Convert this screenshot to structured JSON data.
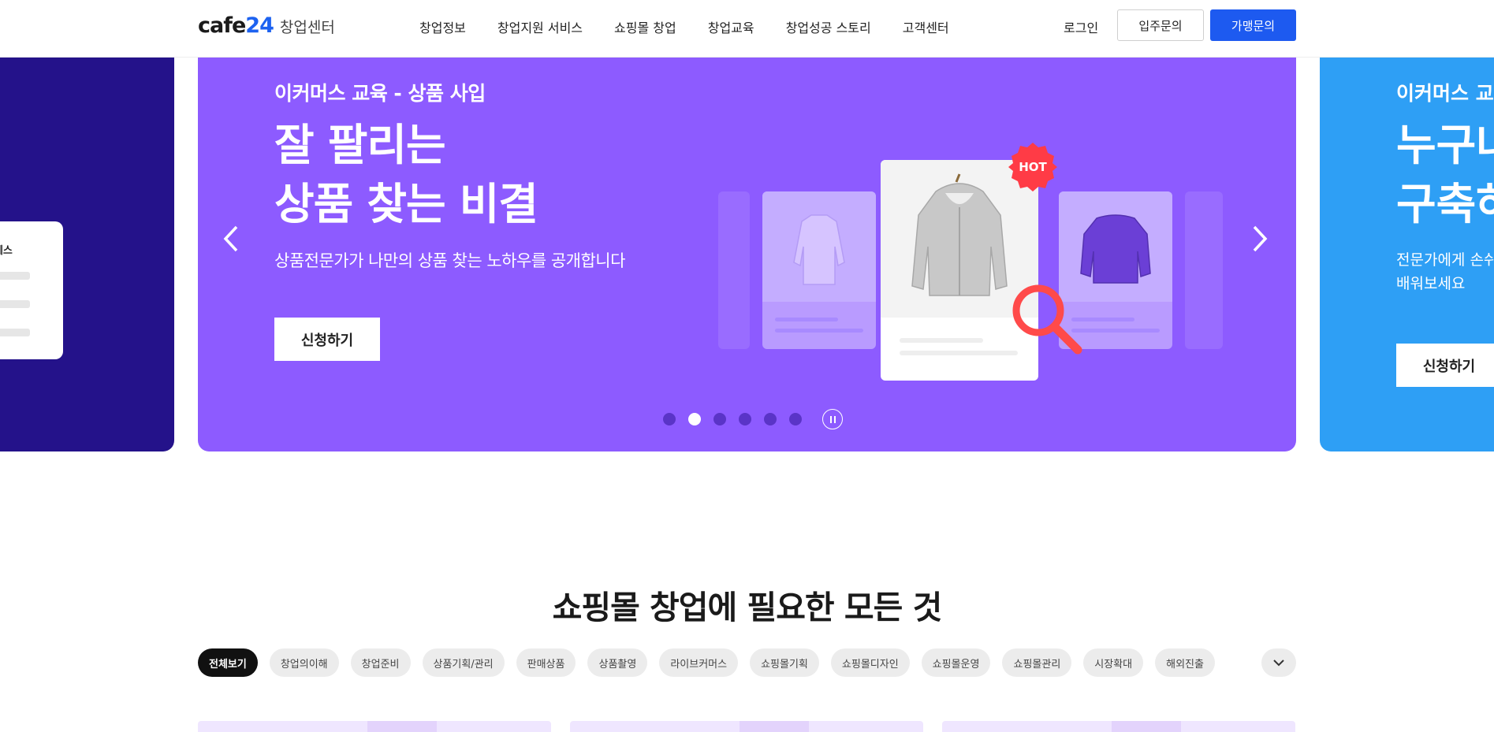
{
  "header": {
    "logo_main": "cafe",
    "logo_num": "24",
    "logo_sub": "창업센터",
    "nav": [
      "창업정보",
      "창업지원 서비스",
      "쇼핑몰 창업",
      "창업교육",
      "창업성공 스토리",
      "고객센터"
    ],
    "login": "로그인",
    "inquiry": "입주문의",
    "franchise": "가맹문의"
  },
  "hero": {
    "left_slide": {
      "card_label": "로세스"
    },
    "main_slide": {
      "kicker": "이커머스 교육 - 상품 사입",
      "title_line1": "잘 팔리는",
      "title_line2": "상품 찾는 비결",
      "description": "상품전문가가 나만의 상품 찾는 노하우를 공개합니다",
      "cta": "신청하기",
      "hot_badge": "HOT",
      "icons": [
        "chevron-left-icon",
        "chevron-right-icon",
        "magnifier-icon",
        "pause-icon"
      ]
    },
    "right_slide": {
      "kicker": "이커머스 교육",
      "title_line1": "누구나",
      "title_line2": "구축하",
      "desc_line1": "전문가에게 손쉬",
      "desc_line2": "배워보세요",
      "cta": "신청하기"
    },
    "slide_count": 6,
    "active_slide": 2,
    "colors": {
      "main_bg": "#8d5bff",
      "left_bg": "#24128a",
      "right_bg": "#2e9ff5",
      "hot": "#ff3b46"
    }
  },
  "section": {
    "title": "쇼핑몰 창업에 필요한 모든 것",
    "chips": [
      "전체보기",
      "창업의이해",
      "창업준비",
      "상품기획/관리",
      "판매상품",
      "상품촬영",
      "라이브커머스",
      "쇼핑몰기획",
      "쇼핑몰디자인",
      "쇼핑몰운영",
      "쇼핑몰관리",
      "시장확대",
      "해외진출"
    ],
    "active_chip": 0,
    "more_icon": "chevron-down-icon"
  }
}
